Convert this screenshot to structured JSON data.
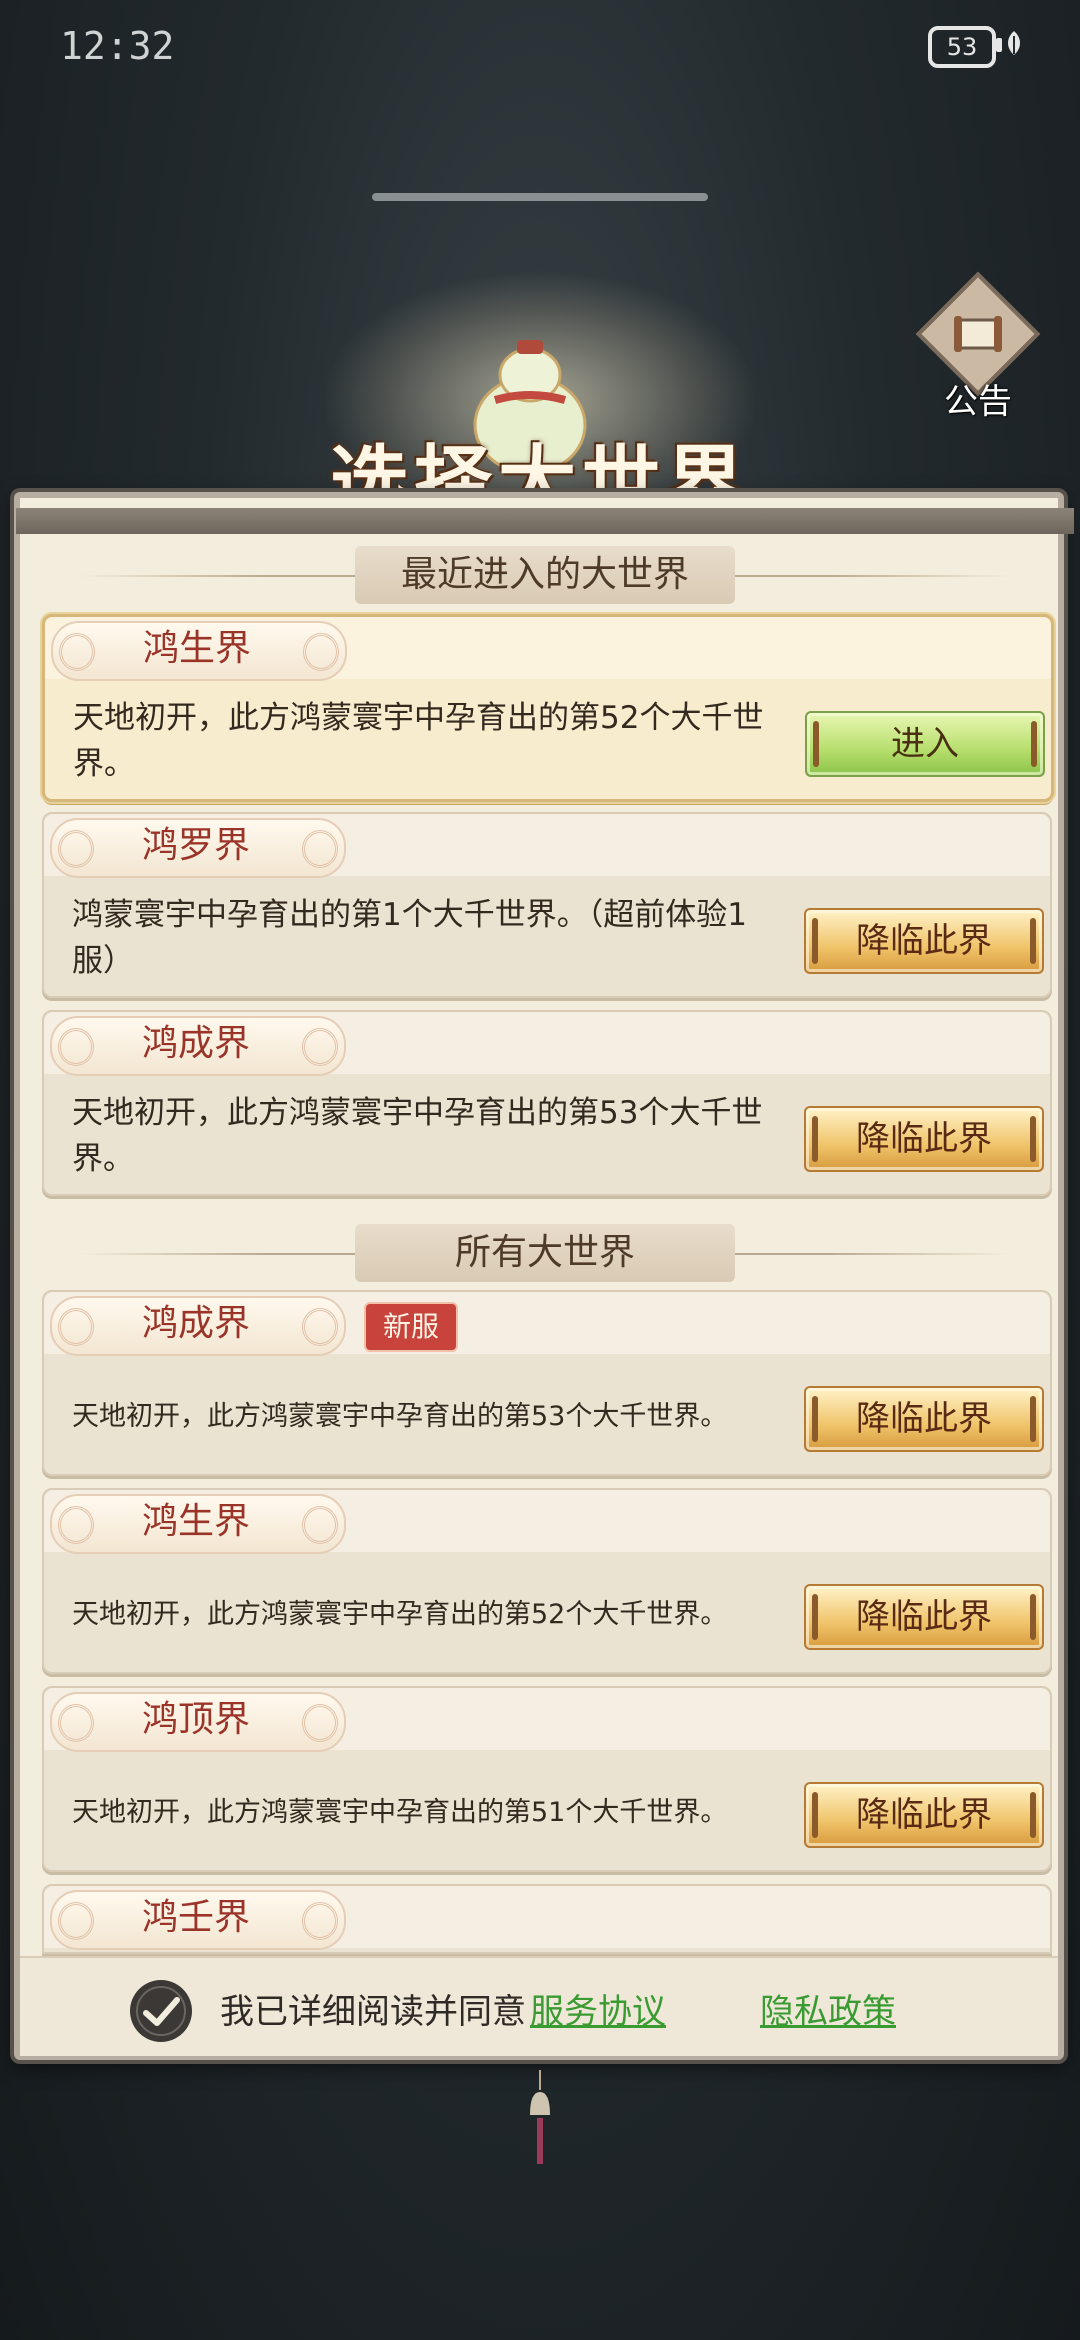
{
  "status_bar": {
    "time": "12:32",
    "battery": "53"
  },
  "header": {
    "title": "选择大世界",
    "notice_label": "公告"
  },
  "recent_section": {
    "title": "最近进入的大世界",
    "worlds": [
      {
        "name": "鸿生界",
        "desc": "天地初开，此方鸿蒙寰宇中孕育出的第52个大千世界。",
        "button": "进入"
      },
      {
        "name": "鸿罗界",
        "desc": "鸿蒙寰宇中孕育出的第1个大千世界。（超前体验1服）",
        "button": "降临此界"
      },
      {
        "name": "鸿成界",
        "desc": "天地初开，此方鸿蒙寰宇中孕育出的第53个大千世界。",
        "button": "降临此界"
      }
    ]
  },
  "all_section": {
    "title": "所有大世界",
    "worlds": [
      {
        "name": "鸿成界",
        "badge": "新服",
        "desc": "天地初开，此方鸿蒙寰宇中孕育出的第53个大千世界。",
        "button": "降临此界"
      },
      {
        "name": "鸿生界",
        "desc": "天地初开，此方鸿蒙寰宇中孕育出的第52个大千世界。",
        "button": "降临此界"
      },
      {
        "name": "鸿顶界",
        "desc": "天地初开，此方鸿蒙寰宇中孕育出的第51个大千世界。",
        "button": "降临此界"
      },
      {
        "name": "鸿壬界"
      }
    ]
  },
  "agreement": {
    "text": "我已详细阅读并同意",
    "service": "服务协议",
    "privacy": "隐私政策"
  },
  "colors": {
    "accent_green": "#3a9b32",
    "gold_button": "#f0c46a",
    "enter_button": "#b6de6c",
    "world_name": "#9a3428"
  }
}
